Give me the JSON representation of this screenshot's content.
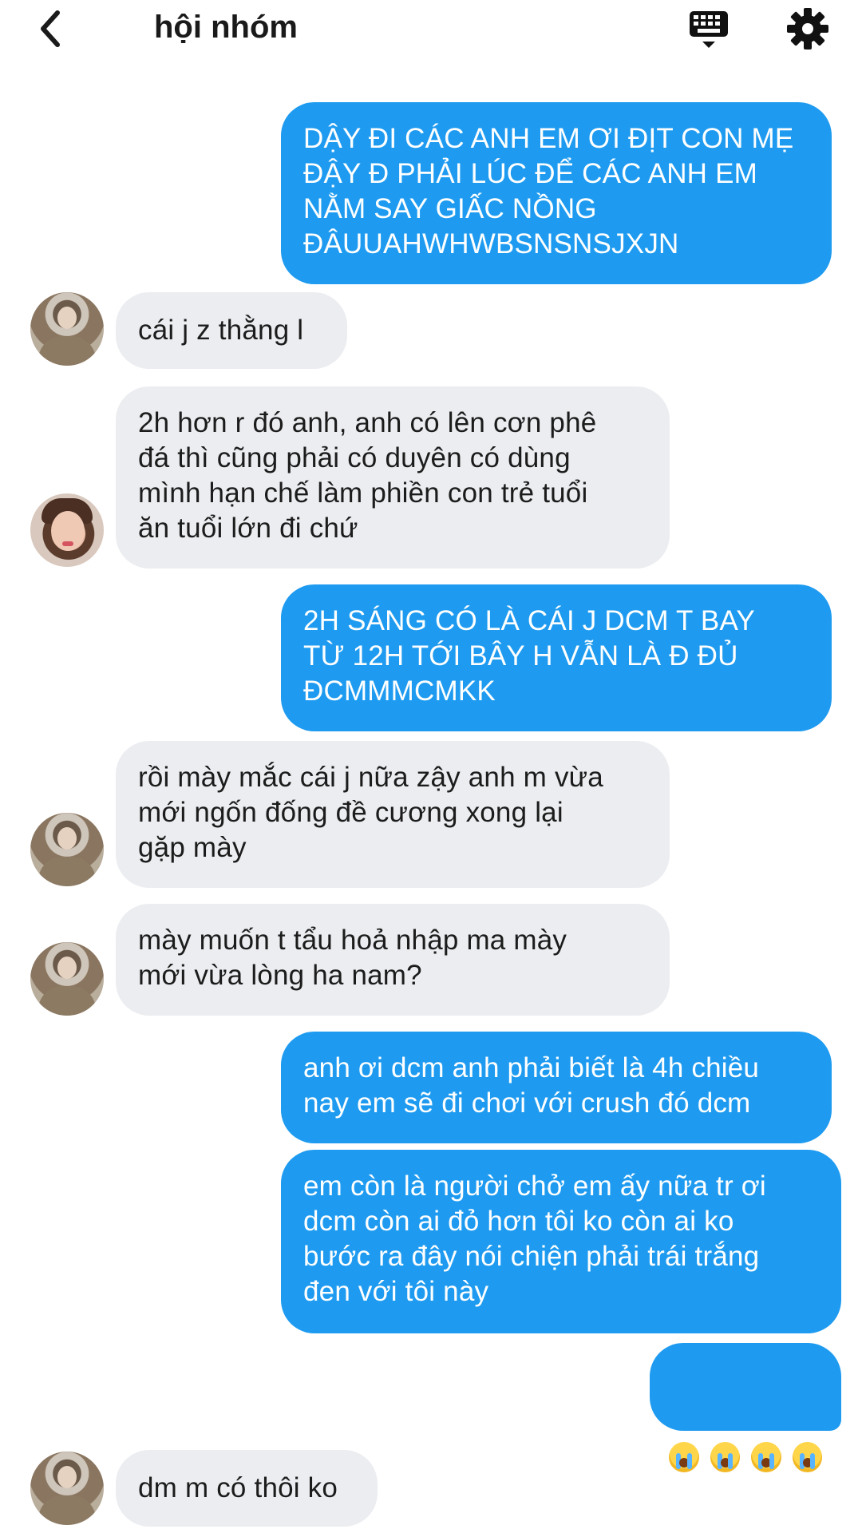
{
  "header": {
    "title": "hội nhóm",
    "back_icon": "chevron-left-icon",
    "keyboard_icon": "keyboard-icon",
    "settings_icon": "gear-icon"
  },
  "colors": {
    "outgoing_bubble": "#1e9bf0",
    "incoming_bubble": "#ebedf0"
  },
  "messages": [
    {
      "from": "me",
      "text": "DẬY ĐI CÁC ANH EM ƠI ĐỊT CON MẸ\nĐẬY Đ PHẢI LÚC ĐỂ CÁC ANH EM\nNẰM SAY GIẤC NỒNG\nĐÂUUAHWHWBSNSNSJXJN"
    },
    {
      "from": "member",
      "text": "cái j z thằng l"
    },
    {
      "from": "member",
      "text": "2h hơn r đó anh, anh có lên cơn phê\nđá thì cũng phải có duyên có dùng\nmình hạn chế làm phiền con trẻ tuổi\năn tuổi lớn đi chứ"
    },
    {
      "from": "me",
      "text": "2H SÁNG CÓ LÀ CÁI J DCM T BAY\nTỪ 12H TỚI BÂY H VẪN LÀ Đ ĐỦ\nĐCMMMCMKK"
    },
    {
      "from": "member",
      "text": "rồi mày mắc cái j nữa zậy anh m vừa\nmới ngốn đống đề cương xong lại\ngặp mày"
    },
    {
      "from": "member",
      "text": "mày muốn t tẩu hoả nhập ma mày\nmới vừa lòng ha nam?"
    },
    {
      "from": "me",
      "text": "anh ơi dcm anh phải biết là 4h chiều\nnay em sẽ đi chơi với crush đó dcm"
    },
    {
      "from": "me",
      "text": "em còn là người chở em ấy nữa tr ơi\ndcm còn ai đỏ hơn tôi ko còn ai ko\nbước ra đây nói chiện phải trái trắng\nđen với tôi này"
    },
    {
      "from": "me",
      "text": "",
      "emoji": "😭😭😭😭"
    },
    {
      "from": "member",
      "text": "dm m có thôi ko"
    }
  ]
}
